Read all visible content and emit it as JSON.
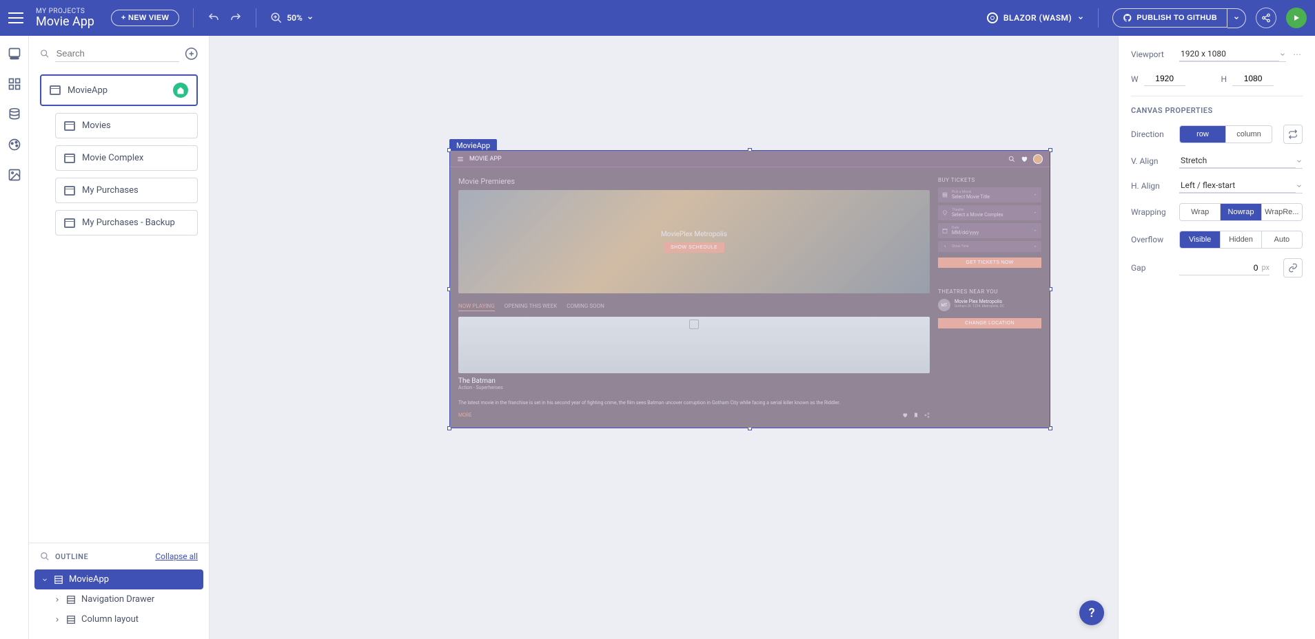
{
  "topbar": {
    "crumb": "MY PROJECTS",
    "projectName": "Movie App",
    "newView": "+ NEW VIEW",
    "zoom": "50%",
    "framework": "BLAZOR (WASM)",
    "publish": "PUBLISH TO GITHUB"
  },
  "leftPanel": {
    "searchPlaceholder": "Search",
    "views": [
      {
        "name": "MovieApp",
        "selected": true,
        "home": true
      },
      {
        "name": "Movies",
        "child": true
      },
      {
        "name": "Movie Complex",
        "child": true
      },
      {
        "name": "My Purchases",
        "child": true
      },
      {
        "name": "My Purchases - Backup",
        "child": true
      }
    ],
    "outlineHeader": "OUTLINE",
    "collapse": "Collapse all",
    "outline": [
      {
        "name": "MovieApp",
        "selected": true,
        "level": 0
      },
      {
        "name": "Navigation Drawer",
        "level": 1
      },
      {
        "name": "Column layout",
        "level": 1
      }
    ]
  },
  "canvas": {
    "tag": "MovieApp"
  },
  "preview": {
    "appTitle": "MOVIE APP",
    "premieresTitle": "Movie Premieres",
    "heroTitle": "MoviePlex Metropolis",
    "heroBtn": "SHOW SCHEDULE",
    "tabs": [
      "NOW PLAYING",
      "OPENING THIS WEEK",
      "COMING SOON"
    ],
    "movieTitle": "The Batman",
    "movieGenre": "Action - Superheroes",
    "movieDesc": "The latest movie in the franchise is set in his second year of fighting crime, the film sees Batman uncover corruption in Gotham City while facing a serial killer known as the Riddler.",
    "more": "MORE",
    "sideBuyTitle": "BUY TICKETS",
    "sideFields": [
      {
        "label": "Pick a Movie",
        "value": "Select Movie Title"
      },
      {
        "label": "Theatre",
        "value": "Select a Movie Complex"
      },
      {
        "label": "Date",
        "value": "MM/dd/yyyy"
      },
      {
        "label": "Show Time",
        "value": ""
      }
    ],
    "getTicketsBtn": "GET TICKETS NOW",
    "theatresTitle": "THEATRES NEAR YOU",
    "theatre": {
      "badge": "MT",
      "name": "Movie Plex Metropolis",
      "addr": "Gotham St. 1234, Metropolis, DC"
    },
    "changeLocationBtn": "CHANGE LOCATION"
  },
  "rightPanel": {
    "viewportLabel": "Viewport",
    "viewportValue": "1920 x 1080",
    "wLabel": "W",
    "wValue": "1920",
    "hLabel": "H",
    "hValue": "1080",
    "sectionTitle": "CANVAS PROPERTIES",
    "direction": {
      "label": "Direction",
      "options": [
        "row",
        "column"
      ],
      "active": "row"
    },
    "valign": {
      "label": "V. Align",
      "value": "Stretch"
    },
    "halign": {
      "label": "H. Align",
      "value": "Left / flex-start"
    },
    "wrapping": {
      "label": "Wrapping",
      "options": [
        "Wrap",
        "Nowrap",
        "WrapRe..."
      ],
      "active": "Nowrap"
    },
    "overflow": {
      "label": "Overflow",
      "options": [
        "Visible",
        "Hidden",
        "Auto"
      ],
      "active": "Visible"
    },
    "gap": {
      "label": "Gap",
      "value": "0",
      "unit": "px"
    }
  }
}
